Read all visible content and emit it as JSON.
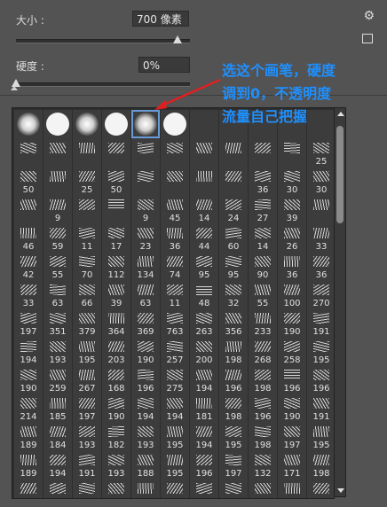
{
  "size": {
    "label": "大小 :",
    "value": "700 像素",
    "slider_fraction": 0.93
  },
  "hardness": {
    "label": "硬度 :",
    "value": "0%",
    "slider_fraction": 0.0
  },
  "annotation": [
    "选这个画笔，硬度",
    "调到0，不透明度",
    "流量自己把握"
  ],
  "colors": {
    "annotation": "#1e90ff",
    "arrow": "#e02020",
    "selected_outline": "#6b9bd6"
  },
  "icons": {
    "settings": "gear-icon",
    "new_preset": "new-preset-icon"
  },
  "brush_rows": [
    [
      "",
      "",
      "",
      "",
      "",
      "",
      "",
      "",
      "",
      "",
      ""
    ],
    [
      "",
      "",
      "",
      "",
      "",
      "",
      "",
      "",
      "",
      "",
      "25"
    ],
    [
      "50",
      "",
      "25",
      "50",
      "",
      "",
      "",
      "",
      "36",
      "30",
      "30"
    ],
    [
      "",
      "9",
      "",
      "",
      "9",
      "45",
      "14",
      "24",
      "27",
      "39",
      ""
    ],
    [
      "46",
      "59",
      "11",
      "17",
      "23",
      "36",
      "44",
      "60",
      "14",
      "26",
      "33"
    ],
    [
      "42",
      "55",
      "70",
      "112",
      "134",
      "74",
      "95",
      "95",
      "90",
      "36",
      "36"
    ],
    [
      "33",
      "63",
      "66",
      "39",
      "63",
      "11",
      "48",
      "32",
      "55",
      "100",
      "270"
    ],
    [
      "197",
      "351",
      "379",
      "364",
      "369",
      "763",
      "263",
      "356",
      "233",
      "190",
      "191"
    ],
    [
      "194",
      "193",
      "195",
      "203",
      "190",
      "257",
      "200",
      "198",
      "268",
      "258",
      "195"
    ],
    [
      "190",
      "259",
      "267",
      "168",
      "196",
      "275",
      "194",
      "196",
      "198",
      "196",
      "196"
    ],
    [
      "214",
      "185",
      "197",
      "190",
      "194",
      "194",
      "181",
      "198",
      "196",
      "190",
      "191"
    ],
    [
      "189",
      "184",
      "193",
      "182",
      "193",
      "195",
      "194",
      "195",
      "198",
      "197",
      "195"
    ],
    [
      "189",
      "194",
      "191",
      "193",
      "188",
      "195",
      "196",
      "197",
      "132",
      "171",
      "198"
    ],
    [
      "",
      "",
      "",
      "",
      "",
      "",
      "",
      "",
      "",
      "",
      ""
    ]
  ],
  "soft_round_row": [
    "soft",
    "hard",
    "soft",
    "hard",
    "soft-selected",
    "hard"
  ]
}
